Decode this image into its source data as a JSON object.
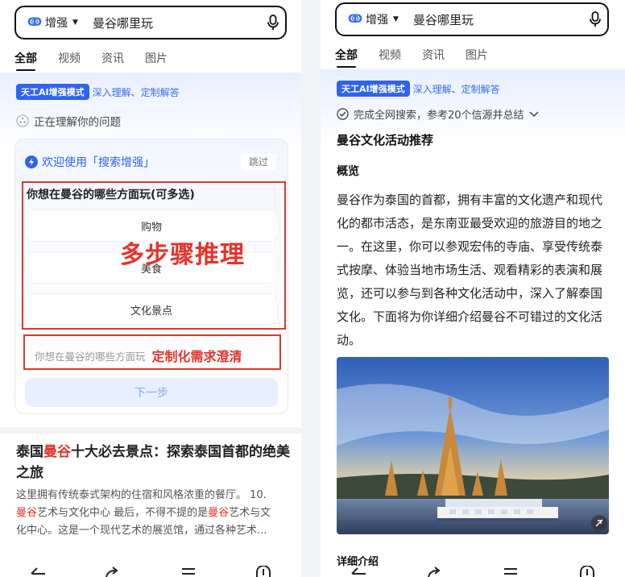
{
  "left": {
    "search": {
      "mode_label": "增强",
      "query": "曼谷哪里玩"
    },
    "tabs": [
      "全部",
      "视频",
      "资讯",
      "图片"
    ],
    "ai_badge": "天工AI增强模式",
    "ai_sub": "深入理解、定制解答",
    "status_text": "正在理解你的问题",
    "survey": {
      "welcome": "欢迎使用「搜索增强」",
      "skip": "跳过",
      "question": "你想在曼谷的哪些方面玩(可多选)",
      "options": [
        "购物",
        "美食",
        "文化景点"
      ],
      "input_placeholder": "你想在曼谷的哪些方面玩",
      "next": "下一步"
    },
    "overlay_big": "多步骤推理",
    "overlay_small": "定制化需求澄清",
    "result": {
      "title_pre": "泰国",
      "title_hl": "曼谷",
      "title_post": "十大必去景点：探索泰国首都的绝美之旅",
      "snippet_1": "这里拥有传统泰式架构的住宿和风格浓重的餐厅。 10.",
      "snippet_2_hl": "曼谷",
      "snippet_2": "艺术与文化中心 最后，不得不提的是",
      "snippet_2b_hl": "曼谷",
      "snippet_2b": "艺术与文",
      "snippet_3": "化中心。这是一个现代艺术的展览馆，通过各种艺术..."
    }
  },
  "right": {
    "search": {
      "mode_label": "增强",
      "query": "曼谷哪里玩"
    },
    "tabs": [
      "全部",
      "视频",
      "资讯",
      "图片"
    ],
    "ai_badge": "天工AI增强模式",
    "ai_sub": "深入理解、定制解答",
    "summary": "完成全网搜索，参考20个信源并总结",
    "heading": "曼谷文化活动推荐",
    "subheading": "概览",
    "body": "曼谷作为泰国的首都，拥有丰富的文化遗产和现代化的都市活态，是东南亚最受欢迎的旅游目的地之一。在这里，你可以参观宏伟的寺庙、享受传统泰式按摩、体验当地市场生活、观看精彩的表演和展览，还可以参与到各种文化活动中，深入了解泰国文化。下面将为你详细介绍曼谷不可错过的文化活动。",
    "cut_heading": "详细介绍"
  },
  "colors": {
    "brand_blue": "#2f63f0",
    "annotation_red": "#e5332a"
  }
}
